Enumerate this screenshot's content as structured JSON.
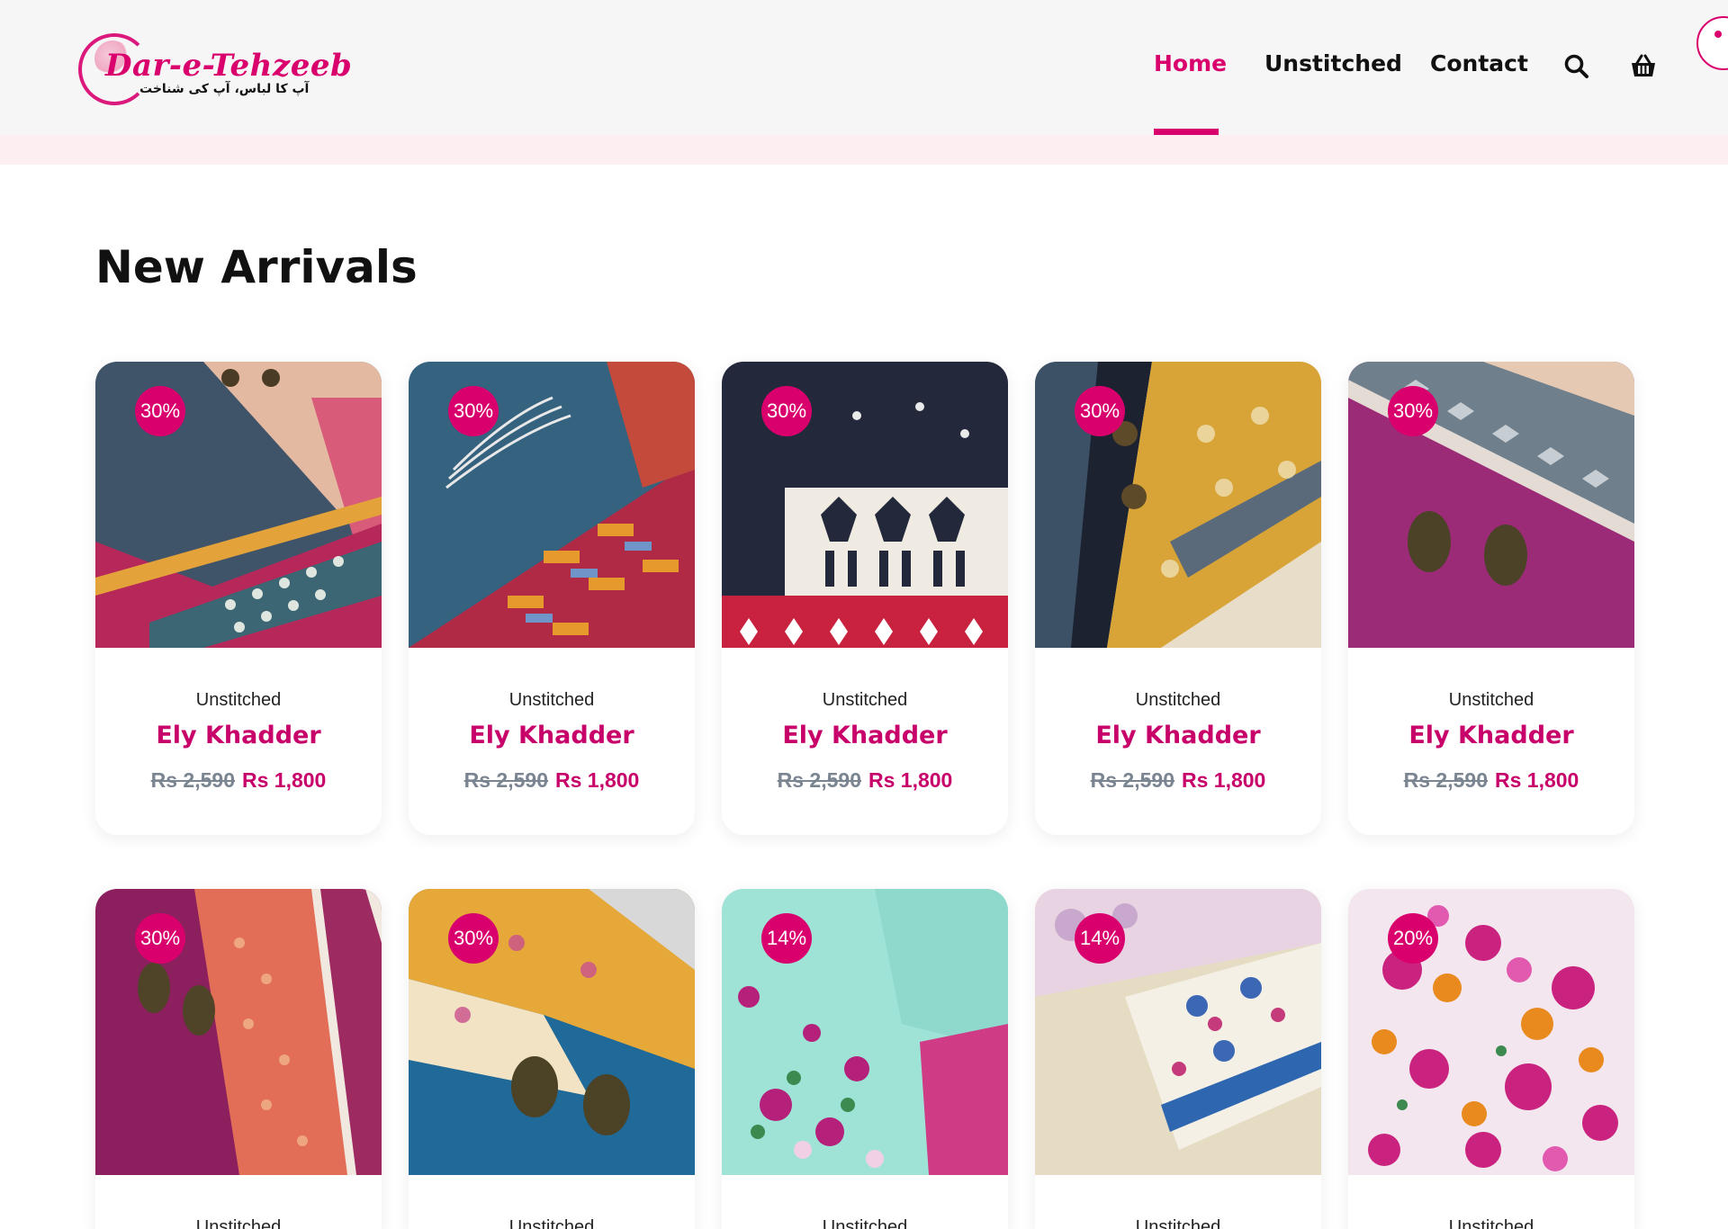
{
  "brand": {
    "name": "Dar-e-Tehzeeb",
    "tagline": "آپ کا لباس، آپ کی شناخت",
    "accent": "#d9006e"
  },
  "nav": {
    "items": [
      {
        "label": "Home",
        "active": true
      },
      {
        "label": "Unstitched",
        "active": false
      },
      {
        "label": "Contact",
        "active": false
      }
    ],
    "icons": [
      "search-icon",
      "basket-icon"
    ]
  },
  "section": {
    "title": "New Arrivals"
  },
  "products": [
    {
      "discount": "30%",
      "category": "Unstitched",
      "name": "Ely Khadder",
      "old_price": "Rs 2,590",
      "new_price": "Rs 1,800"
    },
    {
      "discount": "30%",
      "category": "Unstitched",
      "name": "Ely Khadder",
      "old_price": "Rs 2,590",
      "new_price": "Rs 1,800"
    },
    {
      "discount": "30%",
      "category": "Unstitched",
      "name": "Ely Khadder",
      "old_price": "Rs 2,590",
      "new_price": "Rs 1,800"
    },
    {
      "discount": "30%",
      "category": "Unstitched",
      "name": "Ely Khadder",
      "old_price": "Rs 2,590",
      "new_price": "Rs 1,800"
    },
    {
      "discount": "30%",
      "category": "Unstitched",
      "name": "Ely Khadder",
      "old_price": "Rs 2,590",
      "new_price": "Rs 1,800"
    },
    {
      "discount": "30%",
      "category": "Unstitched"
    },
    {
      "discount": "30%",
      "category": "Unstitched"
    },
    {
      "discount": "14%",
      "category": "Unstitched"
    },
    {
      "discount": "14%",
      "category": "Unstitched"
    },
    {
      "discount": "20%",
      "category": "Unstitched"
    }
  ]
}
